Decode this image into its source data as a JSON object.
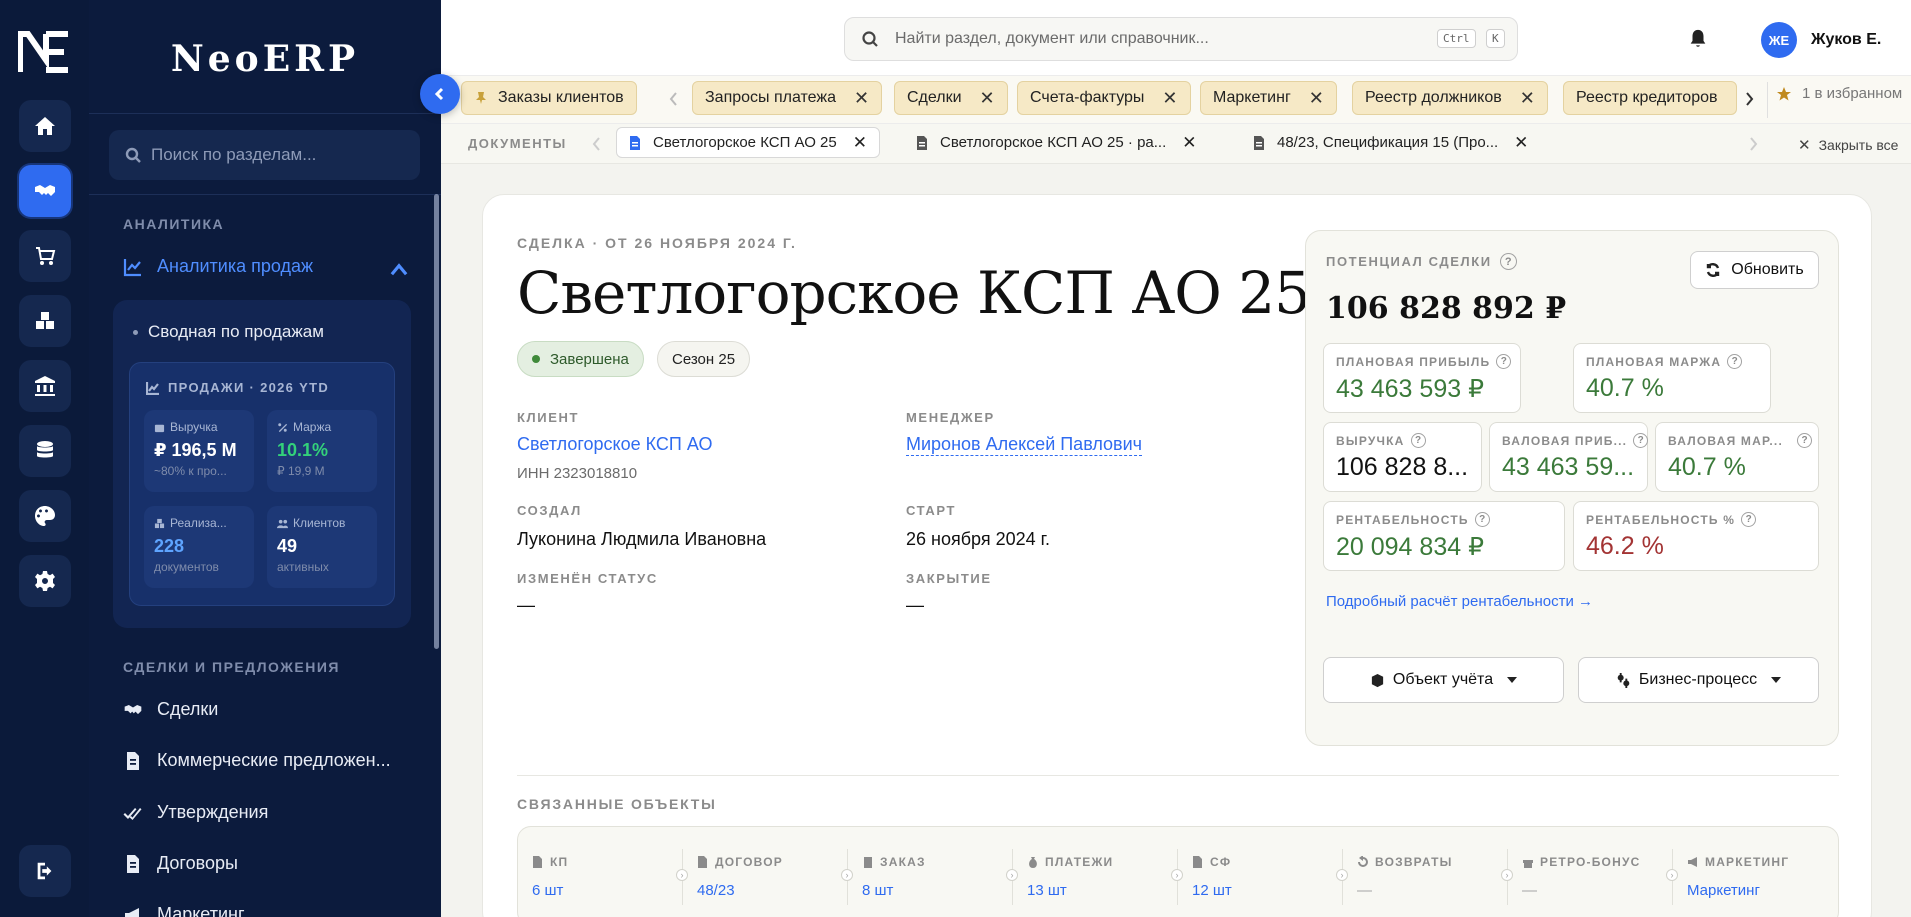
{
  "app": {
    "brand": "NeoERP"
  },
  "rail": {
    "items": [
      {
        "name": "home-icon"
      },
      {
        "name": "handshake-icon",
        "active": true
      },
      {
        "name": "cart-icon"
      },
      {
        "name": "boxes-icon"
      },
      {
        "name": "bank-icon"
      },
      {
        "name": "database-icon"
      },
      {
        "name": "palette-icon"
      },
      {
        "name": "gear-icon"
      }
    ],
    "logout": "logout-icon"
  },
  "sidebar": {
    "search_placeholder": "Поиск по разделам...",
    "section_analytics": "АНАЛИТИКА",
    "analytics_item": "Аналитика продаж",
    "sub_item": "Сводная по продажам",
    "kpi": {
      "title": "ПРОДАЖИ · 2026 YTD",
      "revenue": {
        "label": "Выручка",
        "value": "₽ 196,5 M",
        "sub": "~80% к про..."
      },
      "margin": {
        "label": "Маржа",
        "value": "10.1%",
        "sub": "₽ 19,9 M"
      },
      "realized": {
        "label": "Реализа...",
        "value": "228",
        "sub": "документов"
      },
      "clients": {
        "label": "Клиентов",
        "value": "49",
        "sub": "активных"
      }
    },
    "section_deals": "СДЕЛКИ И ПРЕДЛОЖЕНИЯ",
    "deals_items": [
      "Сделки",
      "Коммерческие предложен...",
      "Утверждения",
      "Договоры",
      "Маркетинг"
    ]
  },
  "topbar": {
    "search_placeholder": "Найти раздел, документ или справочник...",
    "kbd1": "Ctrl",
    "kbd2": "K",
    "avatar_initials": "ЖЕ",
    "username": "Жуков Е."
  },
  "tabs": {
    "pinned": "Заказы клиентов",
    "items": [
      "Запросы платежа",
      "Сделки",
      "Счета-фактуры",
      "Маркетинг",
      "Реестр должников",
      "Реестр кредиторов"
    ],
    "favorites": "1 в избранном"
  },
  "docs": {
    "label": "ДОКУМЕНТЫ",
    "items": [
      "Светлогорское КСП АО 25",
      "Светлогорское КСП АО 25 · ра...",
      "48/23, Спецификация 15 (Про..."
    ],
    "close_all": "Закрыть все"
  },
  "deal": {
    "eyebrow": "СДЕЛКА · ОТ 26 НОЯБРЯ 2024 Г.",
    "title": "Светлогорское КСП АО 25",
    "status": "Завершена",
    "season": "Сезон 25",
    "client_label": "КЛИЕНТ",
    "client": "Светлогорское КСП АО",
    "inn": "ИНН 2323018810",
    "manager_label": "МЕНЕДЖЕР",
    "manager": "Миронов Алексей Павлович",
    "created_label": "СОЗДАЛ",
    "created": "Луконина Людмила Ивановна",
    "start_label": "СТАРТ",
    "start": "26 ноября 2024 г.",
    "status_changed_label": "ИЗМЕНЁН СТАТУС",
    "status_changed": "—",
    "close_label": "ЗАКРЫТИЕ",
    "close": "—"
  },
  "potential": {
    "title": "ПОТЕНЦИАЛ СДЕЛКИ",
    "total": "106 828 892 ₽",
    "refresh": "Обновить",
    "metrics": {
      "plan_profit": {
        "label": "ПЛАНОВАЯ ПРИБЫЛЬ",
        "value": "43 463 593 ₽"
      },
      "plan_margin": {
        "label": "ПЛАНОВАЯ МАРЖА",
        "value": "40.7 %"
      },
      "revenue": {
        "label": "ВЫРУЧКА",
        "value": "106 828 8..."
      },
      "gross_profit": {
        "label": "ВАЛОВАЯ ПРИБ...",
        "value": "43 463 59..."
      },
      "gross_margin": {
        "label": "ВАЛОВАЯ МАР...",
        "value": "40.7 %"
      },
      "profitability": {
        "label": "РЕНТАБЕЛЬНОСТЬ",
        "value": "20 094 834 ₽"
      },
      "profitability_pct": {
        "label": "РЕНТАБЕЛЬНОСТЬ %",
        "value": "46.2 %"
      }
    },
    "detail_link": "Подробный расчёт рентабельности →",
    "btn_object": "Объект учёта",
    "btn_process": "Бизнес-процесс"
  },
  "related": {
    "title": "СВЯЗАННЫЕ ОБЪЕКТЫ",
    "items": [
      {
        "label": "КП",
        "value": "6 шт"
      },
      {
        "label": "ДОГОВОР",
        "value": "48/23"
      },
      {
        "label": "ЗАКАЗ",
        "value": "8 шт"
      },
      {
        "label": "ПЛАТЕЖИ",
        "value": "13 шт"
      },
      {
        "label": "СФ",
        "value": "12 шт"
      },
      {
        "label": "ВОЗВРАТЫ",
        "value": "—"
      },
      {
        "label": "РЕТРО-БОНУС",
        "value": "—"
      },
      {
        "label": "МАРКЕТИНГ",
        "value": "Маркетинг"
      }
    ]
  },
  "colors": {
    "accent": "#2f6bf0",
    "sidebar": "#0c1b3d",
    "green": "#3b7a3a",
    "red": "#a33434"
  }
}
